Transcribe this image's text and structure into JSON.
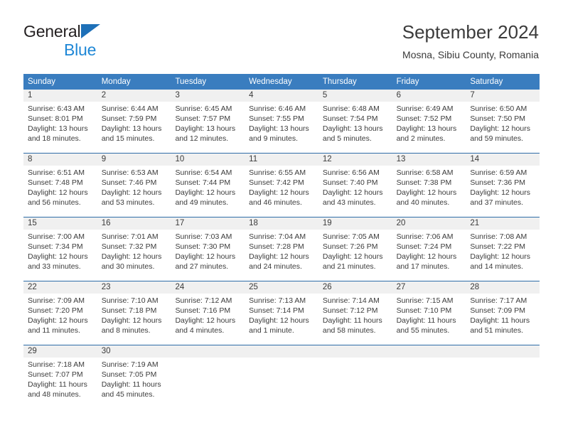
{
  "logo": {
    "word1": "General",
    "word2": "Blue",
    "triangle_color": "#1e70b8",
    "word2_color": "#1e87d6"
  },
  "header": {
    "title": "September 2024",
    "subtitle": "Mosna, Sibiu County, Romania"
  },
  "colors": {
    "header_row_bg": "#3a7dbf",
    "header_row_text": "#ffffff",
    "daynum_band_bg": "#f0f0f0",
    "week_separator": "#2f6da8",
    "body_text": "#3b3b3b"
  },
  "weekdays": [
    "Sunday",
    "Monday",
    "Tuesday",
    "Wednesday",
    "Thursday",
    "Friday",
    "Saturday"
  ],
  "weeks": [
    [
      {
        "day": "1",
        "line1": "Sunrise: 6:43 AM",
        "line2": "Sunset: 8:01 PM",
        "line3": "Daylight: 13 hours",
        "line4": "and 18 minutes."
      },
      {
        "day": "2",
        "line1": "Sunrise: 6:44 AM",
        "line2": "Sunset: 7:59 PM",
        "line3": "Daylight: 13 hours",
        "line4": "and 15 minutes."
      },
      {
        "day": "3",
        "line1": "Sunrise: 6:45 AM",
        "line2": "Sunset: 7:57 PM",
        "line3": "Daylight: 13 hours",
        "line4": "and 12 minutes."
      },
      {
        "day": "4",
        "line1": "Sunrise: 6:46 AM",
        "line2": "Sunset: 7:55 PM",
        "line3": "Daylight: 13 hours",
        "line4": "and 9 minutes."
      },
      {
        "day": "5",
        "line1": "Sunrise: 6:48 AM",
        "line2": "Sunset: 7:54 PM",
        "line3": "Daylight: 13 hours",
        "line4": "and 5 minutes."
      },
      {
        "day": "6",
        "line1": "Sunrise: 6:49 AM",
        "line2": "Sunset: 7:52 PM",
        "line3": "Daylight: 13 hours",
        "line4": "and 2 minutes."
      },
      {
        "day": "7",
        "line1": "Sunrise: 6:50 AM",
        "line2": "Sunset: 7:50 PM",
        "line3": "Daylight: 12 hours",
        "line4": "and 59 minutes."
      }
    ],
    [
      {
        "day": "8",
        "line1": "Sunrise: 6:51 AM",
        "line2": "Sunset: 7:48 PM",
        "line3": "Daylight: 12 hours",
        "line4": "and 56 minutes."
      },
      {
        "day": "9",
        "line1": "Sunrise: 6:53 AM",
        "line2": "Sunset: 7:46 PM",
        "line3": "Daylight: 12 hours",
        "line4": "and 53 minutes."
      },
      {
        "day": "10",
        "line1": "Sunrise: 6:54 AM",
        "line2": "Sunset: 7:44 PM",
        "line3": "Daylight: 12 hours",
        "line4": "and 49 minutes."
      },
      {
        "day": "11",
        "line1": "Sunrise: 6:55 AM",
        "line2": "Sunset: 7:42 PM",
        "line3": "Daylight: 12 hours",
        "line4": "and 46 minutes."
      },
      {
        "day": "12",
        "line1": "Sunrise: 6:56 AM",
        "line2": "Sunset: 7:40 PM",
        "line3": "Daylight: 12 hours",
        "line4": "and 43 minutes."
      },
      {
        "day": "13",
        "line1": "Sunrise: 6:58 AM",
        "line2": "Sunset: 7:38 PM",
        "line3": "Daylight: 12 hours",
        "line4": "and 40 minutes."
      },
      {
        "day": "14",
        "line1": "Sunrise: 6:59 AM",
        "line2": "Sunset: 7:36 PM",
        "line3": "Daylight: 12 hours",
        "line4": "and 37 minutes."
      }
    ],
    [
      {
        "day": "15",
        "line1": "Sunrise: 7:00 AM",
        "line2": "Sunset: 7:34 PM",
        "line3": "Daylight: 12 hours",
        "line4": "and 33 minutes."
      },
      {
        "day": "16",
        "line1": "Sunrise: 7:01 AM",
        "line2": "Sunset: 7:32 PM",
        "line3": "Daylight: 12 hours",
        "line4": "and 30 minutes."
      },
      {
        "day": "17",
        "line1": "Sunrise: 7:03 AM",
        "line2": "Sunset: 7:30 PM",
        "line3": "Daylight: 12 hours",
        "line4": "and 27 minutes."
      },
      {
        "day": "18",
        "line1": "Sunrise: 7:04 AM",
        "line2": "Sunset: 7:28 PM",
        "line3": "Daylight: 12 hours",
        "line4": "and 24 minutes."
      },
      {
        "day": "19",
        "line1": "Sunrise: 7:05 AM",
        "line2": "Sunset: 7:26 PM",
        "line3": "Daylight: 12 hours",
        "line4": "and 21 minutes."
      },
      {
        "day": "20",
        "line1": "Sunrise: 7:06 AM",
        "line2": "Sunset: 7:24 PM",
        "line3": "Daylight: 12 hours",
        "line4": "and 17 minutes."
      },
      {
        "day": "21",
        "line1": "Sunrise: 7:08 AM",
        "line2": "Sunset: 7:22 PM",
        "line3": "Daylight: 12 hours",
        "line4": "and 14 minutes."
      }
    ],
    [
      {
        "day": "22",
        "line1": "Sunrise: 7:09 AM",
        "line2": "Sunset: 7:20 PM",
        "line3": "Daylight: 12 hours",
        "line4": "and 11 minutes."
      },
      {
        "day": "23",
        "line1": "Sunrise: 7:10 AM",
        "line2": "Sunset: 7:18 PM",
        "line3": "Daylight: 12 hours",
        "line4": "and 8 minutes."
      },
      {
        "day": "24",
        "line1": "Sunrise: 7:12 AM",
        "line2": "Sunset: 7:16 PM",
        "line3": "Daylight: 12 hours",
        "line4": "and 4 minutes."
      },
      {
        "day": "25",
        "line1": "Sunrise: 7:13 AM",
        "line2": "Sunset: 7:14 PM",
        "line3": "Daylight: 12 hours",
        "line4": "and 1 minute."
      },
      {
        "day": "26",
        "line1": "Sunrise: 7:14 AM",
        "line2": "Sunset: 7:12 PM",
        "line3": "Daylight: 11 hours",
        "line4": "and 58 minutes."
      },
      {
        "day": "27",
        "line1": "Sunrise: 7:15 AM",
        "line2": "Sunset: 7:10 PM",
        "line3": "Daylight: 11 hours",
        "line4": "and 55 minutes."
      },
      {
        "day": "28",
        "line1": "Sunrise: 7:17 AM",
        "line2": "Sunset: 7:09 PM",
        "line3": "Daylight: 11 hours",
        "line4": "and 51 minutes."
      }
    ],
    [
      {
        "day": "29",
        "line1": "Sunrise: 7:18 AM",
        "line2": "Sunset: 7:07 PM",
        "line3": "Daylight: 11 hours",
        "line4": "and 48 minutes."
      },
      {
        "day": "30",
        "line1": "Sunrise: 7:19 AM",
        "line2": "Sunset: 7:05 PM",
        "line3": "Daylight: 11 hours",
        "line4": "and 45 minutes."
      },
      {
        "day": "",
        "line1": "",
        "line2": "",
        "line3": "",
        "line4": ""
      },
      {
        "day": "",
        "line1": "",
        "line2": "",
        "line3": "",
        "line4": ""
      },
      {
        "day": "",
        "line1": "",
        "line2": "",
        "line3": "",
        "line4": ""
      },
      {
        "day": "",
        "line1": "",
        "line2": "",
        "line3": "",
        "line4": ""
      },
      {
        "day": "",
        "line1": "",
        "line2": "",
        "line3": "",
        "line4": ""
      }
    ]
  ]
}
